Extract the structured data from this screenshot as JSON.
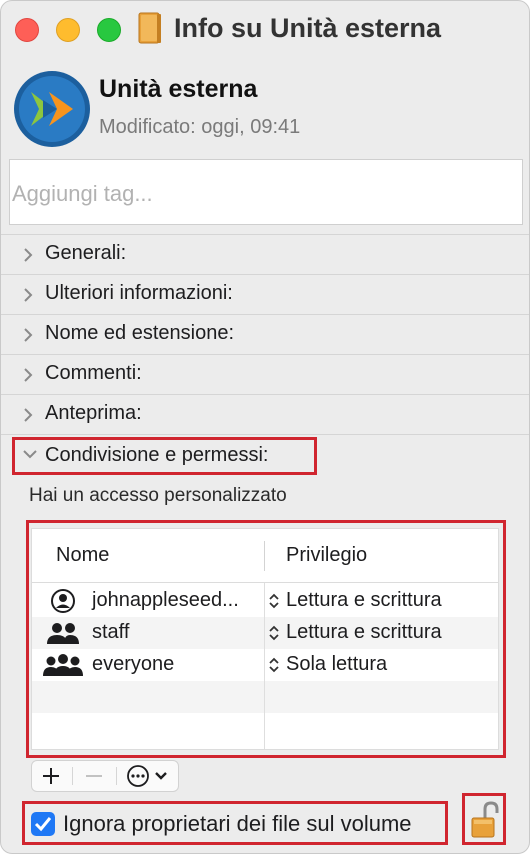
{
  "window": {
    "title": "Info su Unità esterna"
  },
  "header": {
    "name": "Unità esterna",
    "modified": "Modificato: oggi, 09:41"
  },
  "tags": {
    "placeholder": "Aggiungi tag..."
  },
  "sections": [
    {
      "label": "Generali:",
      "expanded": false
    },
    {
      "label": "Ulteriori informazioni:",
      "expanded": false
    },
    {
      "label": "Nome ed estensione:",
      "expanded": false
    },
    {
      "label": "Commenti:",
      "expanded": false
    },
    {
      "label": "Anteprima:",
      "expanded": false
    },
    {
      "label": "Condivisione e permessi:",
      "expanded": true
    }
  ],
  "permissions": {
    "info": "Hai un accesso personalizzato",
    "columns": [
      "Nome",
      "Privilegio"
    ],
    "rows": [
      {
        "name": "johnappleseed...",
        "privilege": "Lettura e scrittura",
        "icon": "user-circle-icon"
      },
      {
        "name": "staff",
        "privilege": "Lettura e scrittura",
        "icon": "group-icon"
      },
      {
        "name": "everyone",
        "privilege": "Sola lettura",
        "icon": "everyone-icon"
      }
    ]
  },
  "toolbar": {
    "add": "+",
    "remove": "—",
    "more": "···"
  },
  "options": {
    "ignore_owners_label": "Ignora proprietari dei file sul volume",
    "ignore_owners_checked": true
  },
  "colors": {
    "highlight": "#d0252f",
    "accent": "#1f78f5"
  }
}
